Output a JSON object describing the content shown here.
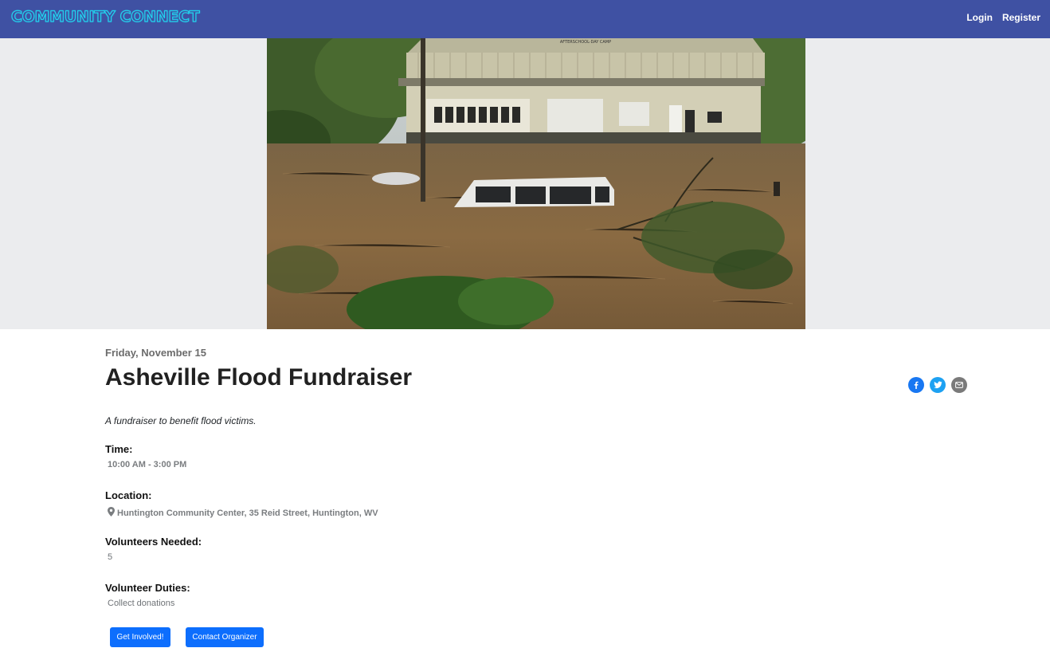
{
  "navbar": {
    "brand": "COMMUNITY CONNECT",
    "links": {
      "login": "Login",
      "register": "Register"
    }
  },
  "hero": {
    "image_subject": "flooded building with submerged van",
    "building_sign": "AFTERSCHOOL·DAY CAMP"
  },
  "event": {
    "date": "Friday, November 15",
    "title": "Asheville Flood Fundraiser",
    "description": "A fundraiser to benefit flood victims.",
    "time_label": "Time:",
    "time_value": "10:00 AM - 3:00 PM",
    "location_label": "Location:",
    "location_value": "Huntington Community Center, 35 Reid Street, Huntington, WV",
    "volunteers_label": "Volunteers Needed:",
    "volunteers_value": "5",
    "duties_label": "Volunteer Duties:",
    "duties_value": "Collect donations"
  },
  "share": {
    "icons": [
      "facebook-icon",
      "twitter-icon",
      "email-icon"
    ]
  },
  "actions": {
    "get_involved": "Get Involved!",
    "contact_organizer": "Contact Organizer"
  },
  "colors": {
    "navbar": "#3f51a3",
    "brand_outline": "#22d3ee",
    "primary_button": "#0d6efd",
    "hero_bg": "#ebecee"
  }
}
